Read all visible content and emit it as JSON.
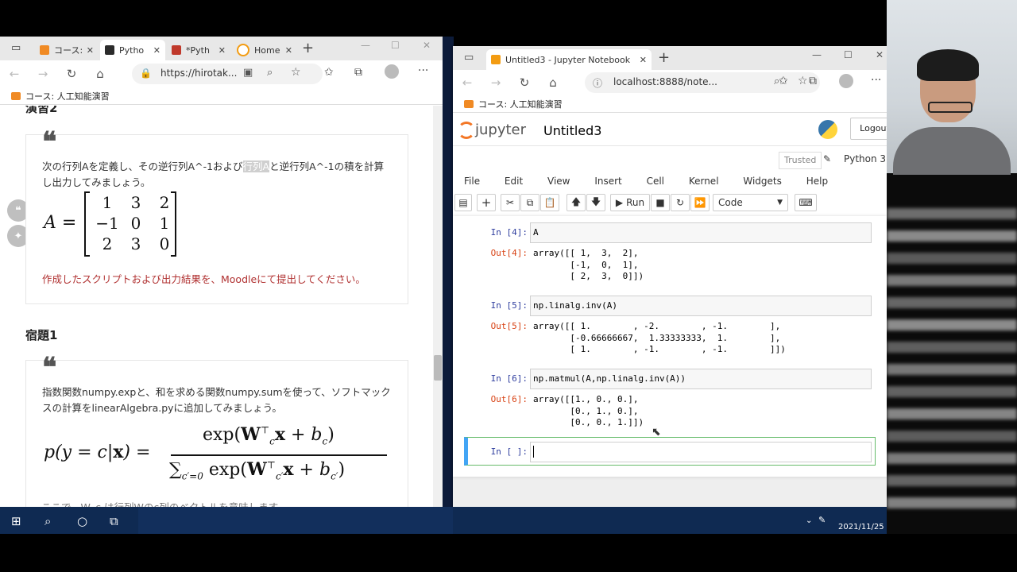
{
  "left_browser": {
    "tabs": [
      {
        "label": "コース:",
        "fav_color": "#f08a24"
      },
      {
        "label": "Pytho",
        "fav_color": "#2b2b2b"
      },
      {
        "label": "*Pyth",
        "fav_color": "#c0392b"
      },
      {
        "label": "Home",
        "fav_color": "#f39c12"
      }
    ],
    "url": "https://hirotak...",
    "favorite": "コース: 人工知能演習",
    "section_partial": "演習2",
    "ex2_text_a": "次の行列Aを定義し、その逆行列A^-1および",
    "ex2_text_hl": "行列A",
    "ex2_text_b": "と逆行列A^-1の積を計算し出力してみましょう。",
    "matrix_label": "A =",
    "matrix_rows": [
      [
        "1",
        "3",
        "2"
      ],
      [
        "−1",
        "0",
        "1"
      ],
      [
        "2",
        "3",
        "0"
      ]
    ],
    "submit_note": "作成したスクリプトおよび出力結果を、Moodleにて提出してください。",
    "homework_title": "宿題1",
    "hw_text": "指数関数numpy.expと、和を求める関数numpy.sumを使って、ソフトマックスの計算をlinearAlgebra.pyに追加してみましょう。",
    "footer_partial": "ここで、W_c は行列Wのc列のベクトルを意味します。"
  },
  "right_browser": {
    "tab_title": "Untitled3 - Jupyter Notebook",
    "url": "localhost:8888/note...",
    "favorite": "コース: 人工知能演習",
    "jupyter_logo": "jupyter",
    "notebook_name": "Untitled3",
    "logout": "Logout",
    "trusted": "Trusted",
    "kernel": "Python 3",
    "menu": [
      "File",
      "Edit",
      "View",
      "Insert",
      "Cell",
      "Kernel",
      "Widgets",
      "Help"
    ],
    "run_label": "Run",
    "celltype": "Code",
    "cells": [
      {
        "in": "In [4]:",
        "code": "A",
        "out": "Out[4]:",
        "output": "array([[ 1,  3,  2],\n       [-1,  0,  1],\n       [ 2,  3,  0]])"
      },
      {
        "in": "In [5]:",
        "code": "np.linalg.inv(A)",
        "out": "Out[5]:",
        "output": "array([[ 1.        , -2.        , -1.        ],\n       [-0.66666667,  1.33333333,  1.        ],\n       [ 1.        , -1.        , -1.        ]])"
      },
      {
        "in": "In [6]:",
        "code": "np.matmul(A,np.linalg.inv(A))",
        "out": "Out[6]:",
        "output": "array([[1., 0., 0.],\n       [0., 1., 0.],\n       [0., 0., 1.]])"
      }
    ],
    "empty_prompt": "In [ ]:"
  },
  "taskbar": {
    "date": "2021/11/25"
  }
}
